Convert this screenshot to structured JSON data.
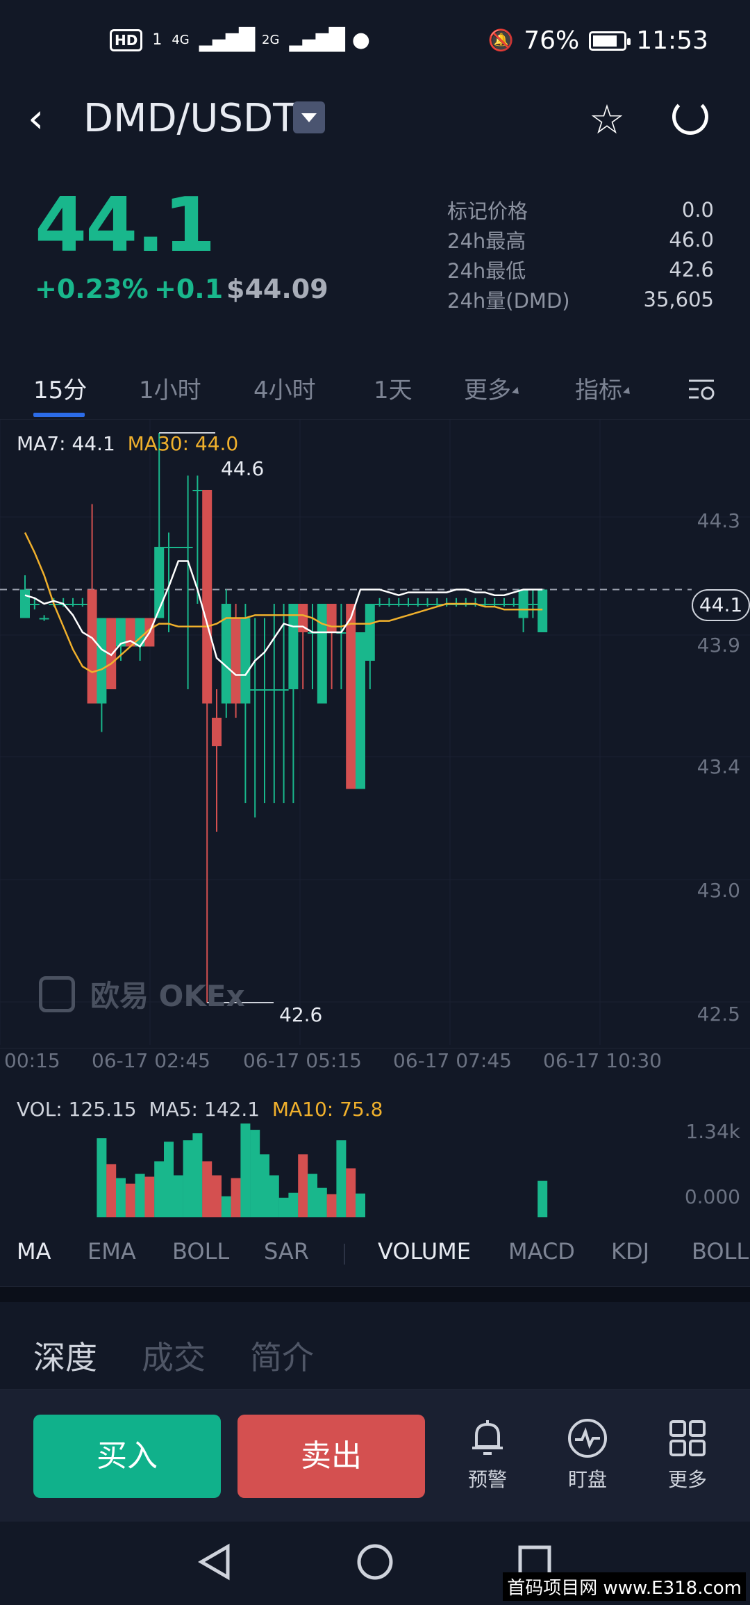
{
  "status": {
    "left_hd": "HD",
    "left_1": "1",
    "net1": "4G",
    "net2": "2G",
    "battery": "76%",
    "time": "11:53"
  },
  "header": {
    "pair": "DMD/USDT"
  },
  "ticker": {
    "price": "44.1",
    "change_pct": "+0.23%",
    "change_abs": "+0.1",
    "usd_price": "$44.09"
  },
  "stats": [
    {
      "label": "标记价格",
      "value": "0.0"
    },
    {
      "label": "24h最高",
      "value": "46.0"
    },
    {
      "label": "24h最低",
      "value": "42.6"
    },
    {
      "label": "24h量(DMD)",
      "value": "35,605"
    }
  ],
  "tabs": [
    "15分",
    "1小时",
    "4小时",
    "1天",
    "更多",
    "指标"
  ],
  "legend": {
    "ma7": "MA7: 44.1",
    "ma30": "MA30: 44.0",
    "vol": "VOL: 125.15",
    "ma5": "MA5: 142.1",
    "ma10": "MA10: 75.8"
  },
  "yaxis": [
    "44.3",
    "43.9",
    "43.4",
    "43.0",
    "42.5"
  ],
  "vol_axis": [
    "1.34k",
    "0.000"
  ],
  "xaxis": [
    "00:15",
    "06-17 02:45",
    "06-17 05:15",
    "06-17 07:45",
    "06-17 10:30"
  ],
  "last_price_tag": "44.1",
  "high_label": "44.6",
  "low_label": "42.6",
  "watermark": "欧易 OKEx",
  "indicators": [
    "MA",
    "EMA",
    "BOLL",
    "SAR",
    "VOLUME",
    "MACD",
    "KDJ",
    "BOLL"
  ],
  "subtabs": [
    "深度",
    "成交",
    "简介"
  ],
  "actions": {
    "buy": "买入",
    "sell": "卖出",
    "alert": "预警",
    "watch": "盯盘",
    "more": "更多"
  },
  "site_watermark": "首码项目网 www.E318.com",
  "colors": {
    "up": "#19b78c",
    "down": "#d45050",
    "ma_white": "#ffffff",
    "ma_yellow": "#f0b02c",
    "accent": "#2c6ce8"
  },
  "chart_data": {
    "type": "candlestick",
    "ylim": [
      42.5,
      44.7
    ],
    "candles": [
      {
        "o": 43.95,
        "c": 44.05,
        "h": 44.1,
        "l": 43.95
      },
      {
        "o": 44.0,
        "c": 44.0,
        "h": 44.02,
        "l": 43.98
      },
      {
        "o": 43.95,
        "c": 43.95,
        "h": 43.96,
        "l": 43.94
      },
      {
        "o": 44.0,
        "c": 44.0,
        "h": 44.02,
        "l": 43.99
      },
      {
        "o": 44.0,
        "c": 44.0,
        "h": 44.02,
        "l": 43.99
      },
      {
        "o": 44.0,
        "c": 44.0,
        "h": 44.02,
        "l": 43.99
      },
      {
        "o": 44.0,
        "c": 44.0,
        "h": 44.02,
        "l": 43.99
      },
      {
        "o": 44.05,
        "c": 43.65,
        "h": 44.35,
        "l": 43.65
      },
      {
        "o": 43.65,
        "c": 43.95,
        "h": 43.95,
        "l": 43.55
      },
      {
        "o": 43.95,
        "c": 43.7,
        "h": 43.95,
        "l": 43.7
      },
      {
        "o": 43.85,
        "c": 43.95,
        "h": 43.95,
        "l": 43.8
      },
      {
        "o": 43.95,
        "c": 43.85,
        "h": 43.95,
        "l": 43.85
      },
      {
        "o": 43.85,
        "c": 43.95,
        "h": 43.95,
        "l": 43.8
      },
      {
        "o": 43.95,
        "c": 43.85,
        "h": 43.95,
        "l": 43.85
      },
      {
        "o": 43.95,
        "c": 44.2,
        "h": 44.6,
        "l": 43.95
      },
      {
        "o": 44.2,
        "c": 44.2,
        "h": 44.25,
        "l": 43.9
      },
      {
        "o": 44.2,
        "c": 44.2,
        "h": 44.2,
        "l": 44.2
      },
      {
        "o": 44.2,
        "c": 44.2,
        "h": 44.45,
        "l": 43.7
      },
      {
        "o": 44.4,
        "c": 44.4,
        "h": 44.45,
        "l": 44.0
      },
      {
        "o": 44.4,
        "c": 43.65,
        "h": 44.4,
        "l": 42.6
      },
      {
        "o": 43.6,
        "c": 43.5,
        "h": 43.7,
        "l": 43.2
      },
      {
        "o": 43.65,
        "c": 44.0,
        "h": 44.05,
        "l": 43.6
      },
      {
        "o": 43.95,
        "c": 43.65,
        "h": 44.0,
        "l": 43.6
      },
      {
        "o": 43.65,
        "c": 43.95,
        "h": 44.0,
        "l": 43.3
      },
      {
        "o": 43.7,
        "c": 43.7,
        "h": 43.95,
        "l": 43.25
      },
      {
        "o": 43.7,
        "c": 43.7,
        "h": 43.95,
        "l": 43.3
      },
      {
        "o": 43.7,
        "c": 43.7,
        "h": 44.0,
        "l": 43.3
      },
      {
        "o": 43.7,
        "c": 43.7,
        "h": 44.0,
        "l": 43.3
      },
      {
        "o": 43.7,
        "c": 44.0,
        "h": 44.0,
        "l": 43.3
      },
      {
        "o": 44.0,
        "c": 43.9,
        "h": 44.0,
        "l": 43.7
      },
      {
        "o": 43.9,
        "c": 43.9,
        "h": 44.0,
        "l": 43.7
      },
      {
        "o": 43.65,
        "c": 44.0,
        "h": 44.0,
        "l": 43.65
      },
      {
        "o": 44.0,
        "c": 43.9,
        "h": 44.0,
        "l": 43.7
      },
      {
        "o": 43.9,
        "c": 43.9,
        "h": 44.0,
        "l": 43.7
      },
      {
        "o": 44.0,
        "c": 43.35,
        "h": 44.0,
        "l": 43.35
      },
      {
        "o": 43.35,
        "c": 43.9,
        "h": 43.9,
        "l": 43.35
      },
      {
        "o": 43.8,
        "c": 44.0,
        "h": 44.0,
        "l": 43.7
      },
      {
        "o": 44.0,
        "c": 44.0,
        "h": 44.02,
        "l": 43.99
      },
      {
        "o": 44.0,
        "c": 44.0,
        "h": 44.02,
        "l": 43.99
      },
      {
        "o": 44.0,
        "c": 44.0,
        "h": 44.02,
        "l": 43.99
      },
      {
        "o": 44.0,
        "c": 44.0,
        "h": 44.02,
        "l": 43.99
      },
      {
        "o": 44.0,
        "c": 44.0,
        "h": 44.02,
        "l": 43.99
      },
      {
        "o": 44.0,
        "c": 44.0,
        "h": 44.02,
        "l": 43.99
      },
      {
        "o": 44.0,
        "c": 44.0,
        "h": 44.02,
        "l": 43.99
      },
      {
        "o": 44.0,
        "c": 44.0,
        "h": 44.02,
        "l": 43.99
      },
      {
        "o": 44.0,
        "c": 44.0,
        "h": 44.02,
        "l": 43.99
      },
      {
        "o": 44.0,
        "c": 44.0,
        "h": 44.02,
        "l": 43.99
      },
      {
        "o": 44.0,
        "c": 44.0,
        "h": 44.02,
        "l": 43.99
      },
      {
        "o": 44.0,
        "c": 44.0,
        "h": 44.02,
        "l": 43.99
      },
      {
        "o": 44.0,
        "c": 44.0,
        "h": 44.02,
        "l": 43.99
      },
      {
        "o": 44.0,
        "c": 44.0,
        "h": 44.02,
        "l": 43.99
      },
      {
        "o": 44.0,
        "c": 44.0,
        "h": 44.02,
        "l": 43.99
      },
      {
        "o": 43.95,
        "c": 44.05,
        "h": 44.05,
        "l": 43.9
      },
      {
        "o": 44.0,
        "c": 44.0,
        "h": 44.05,
        "l": 43.95
      },
      {
        "o": 43.9,
        "c": 44.05,
        "h": 44.05,
        "l": 43.9
      }
    ],
    "ma7": [
      44.03,
      44.02,
      44.0,
      44.01,
      44.0,
      43.96,
      43.9,
      43.88,
      43.84,
      43.82,
      43.86,
      43.87,
      43.85,
      43.9,
      43.98,
      44.06,
      44.15,
      44.15,
      44.05,
      43.93,
      43.81,
      43.78,
      43.75,
      43.75,
      43.8,
      43.83,
      43.88,
      43.93,
      43.92,
      43.92,
      43.9,
      43.9,
      43.9,
      43.9,
      43.95,
      44.05,
      44.05,
      44.05,
      44.04,
      44.03,
      44.04,
      44.04,
      44.04,
      44.04,
      44.04,
      44.05,
      44.05,
      44.04,
      44.04,
      44.03,
      44.03,
      44.04,
      44.05,
      44.05,
      44.05
    ],
    "ma30": [
      44.25,
      44.18,
      44.1,
      44.0,
      43.92,
      43.84,
      43.78,
      43.76,
      43.77,
      43.79,
      43.82,
      43.85,
      43.88,
      43.91,
      43.93,
      43.93,
      43.92,
      43.92,
      43.92,
      43.92,
      43.93,
      43.95,
      43.95,
      43.95,
      43.96,
      43.96,
      43.96,
      43.96,
      43.96,
      43.96,
      43.95,
      43.93,
      43.92,
      43.92,
      43.93,
      43.93,
      43.93,
      43.94,
      43.94,
      43.95,
      43.96,
      43.97,
      43.98,
      43.99,
      44.0,
      44.0,
      44.0,
      44.0,
      43.99,
      43.99,
      43.98,
      43.98,
      43.98,
      43.98,
      43.98
    ],
    "volumes": [
      0,
      0,
      0,
      0,
      0,
      0,
      0,
      0,
      1130,
      760,
      560,
      480,
      620,
      580,
      800,
      1080,
      600,
      1100,
      1200,
      800,
      600,
      300,
      560,
      1340,
      1250,
      900,
      600,
      280,
      350,
      900,
      620,
      420,
      330,
      1100,
      700,
      340,
      0,
      0,
      0,
      0,
      0,
      0,
      0,
      0,
      0,
      0,
      0,
      0,
      0,
      0,
      0,
      0,
      0,
      0,
      520
    ],
    "vol_ylim": [
      0,
      1340
    ]
  }
}
